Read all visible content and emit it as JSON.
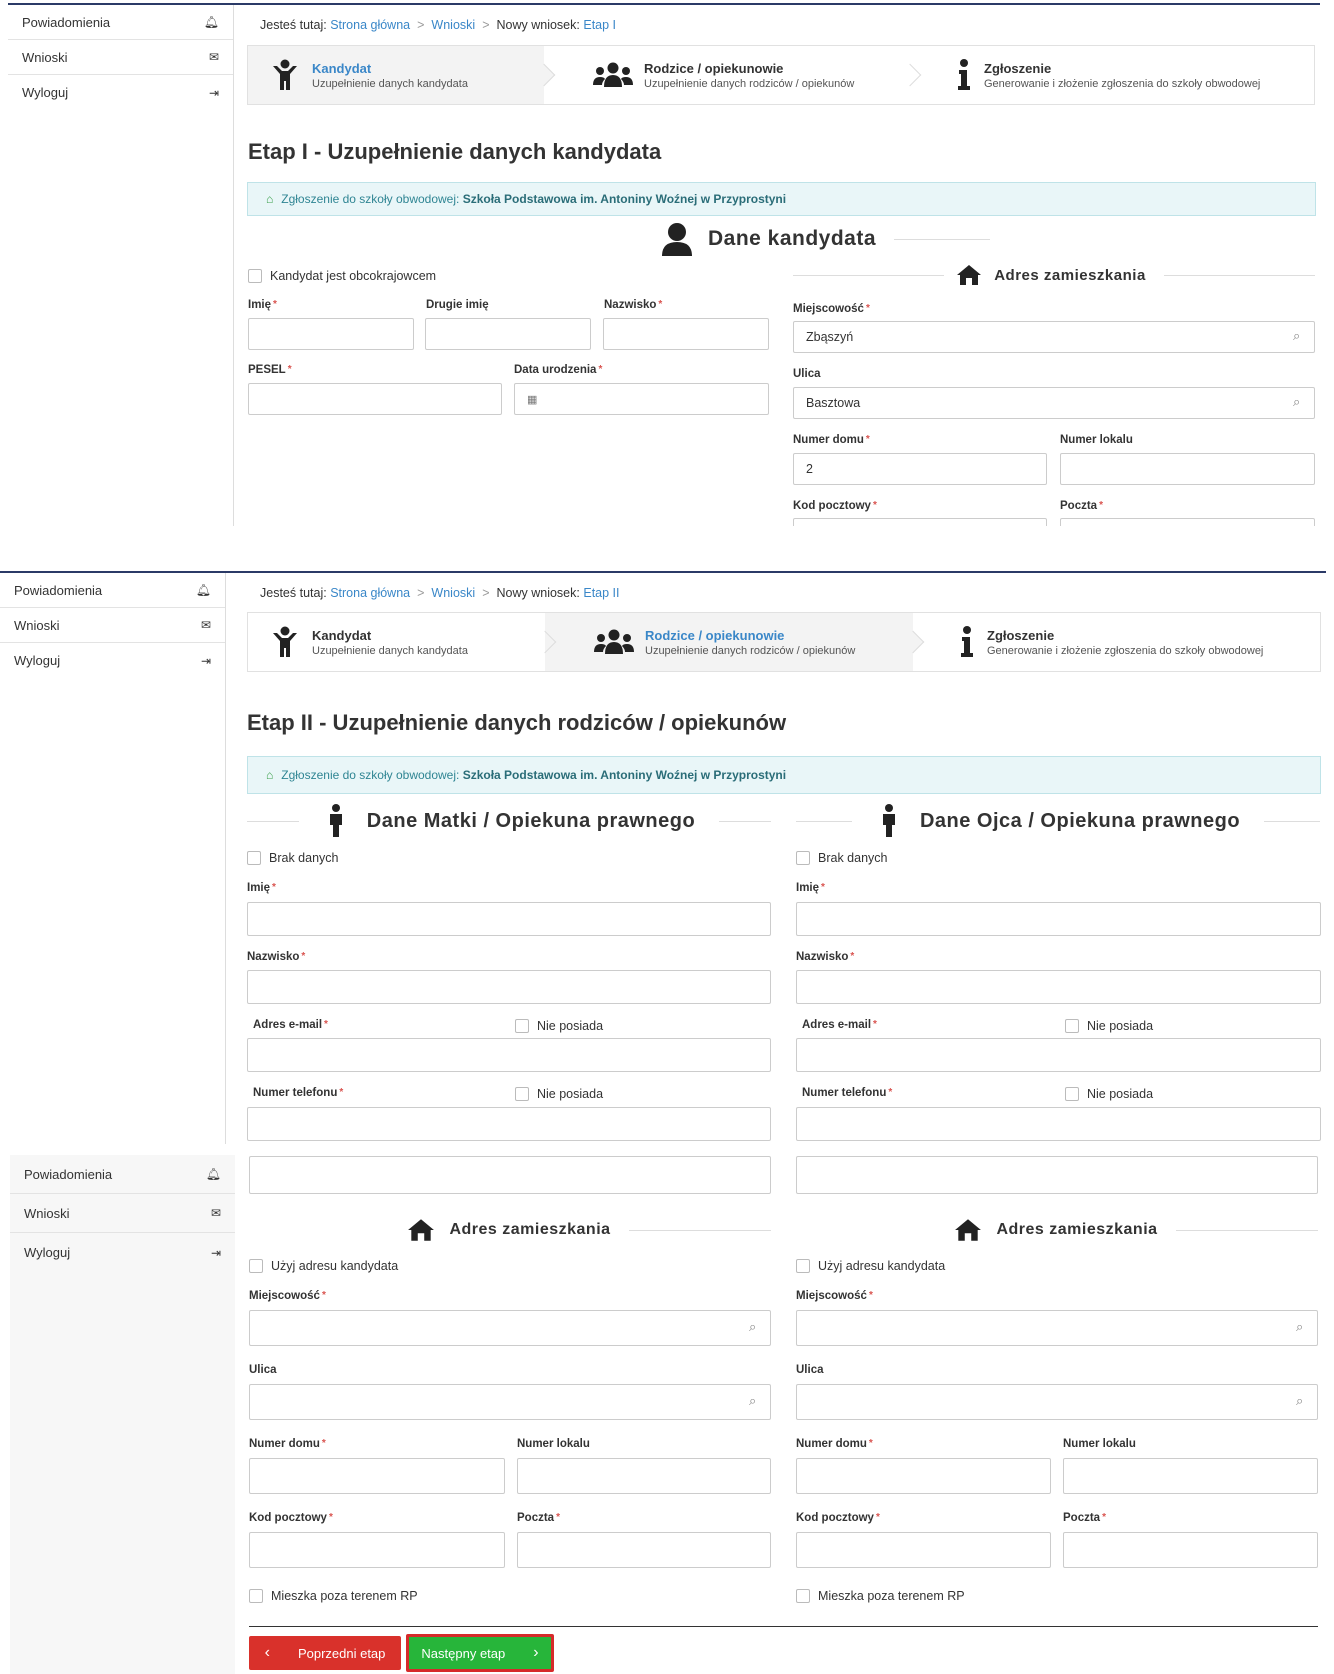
{
  "sidebar": {
    "items": [
      {
        "label": "Powiadomienia",
        "icon": "bell-icon"
      },
      {
        "label": "Wnioski",
        "icon": "envelope-icon"
      },
      {
        "label": "Wyloguj",
        "icon": "sign-out-icon"
      }
    ]
  },
  "breadcrumb": {
    "prefix": "Jesteś tutaj:",
    "home": "Strona główna",
    "requests": "Wnioski",
    "current_label": "Nowy wniosek:",
    "stage1": "Etap I",
    "stage2": "Etap II"
  },
  "steps": [
    {
      "title": "Kandydat",
      "subtitle": "Uzupełnienie danych kandydata"
    },
    {
      "title": "Rodzice / opiekunowie",
      "subtitle": "Uzupełnienie danych rodziców / opiekunów"
    },
    {
      "title": "Zgłoszenie",
      "subtitle": "Generowanie i złożenie zgłoszenia do szkoły obwodowej"
    }
  ],
  "stage1": {
    "heading": "Etap I - Uzupełnienie danych kandydata",
    "alert_prefix": "Zgłoszenie do szkoły obwodowej:",
    "alert_school": "Szkoła Podstawowa im. Antoniny Woźnej w Przyprostyni",
    "section_title": "Dane kandydata",
    "foreigner_label": "Kandydat jest obcokrajowcem",
    "first_name_label": "Imię",
    "second_name_label": "Drugie imię",
    "surname_label": "Nazwisko",
    "pesel_label": "PESEL",
    "birth_date_label": "Data urodzenia",
    "address_title": "Adres zamieszkania",
    "city_label": "Miejscowość",
    "city_value": "Zbąszyń",
    "street_label": "Ulica",
    "street_value": "Basztowa",
    "house_label": "Numer domu",
    "house_value": "2",
    "flat_label": "Numer lokalu",
    "postal_label": "Kod pocztowy",
    "post_label": "Poczta"
  },
  "stage2": {
    "heading": "Etap II - Uzupełnienie danych rodziców / opiekunów",
    "mother_title": "Dane Matki / Opiekuna prawnego",
    "father_title": "Dane Ojca / Opiekuna prawnego",
    "no_data": "Brak danych",
    "first_name_label": "Imię",
    "surname_label": "Nazwisko",
    "email_label": "Adres e-mail",
    "phone_label": "Numer telefonu",
    "none_label": "Nie posiada",
    "address_title": "Adres zamieszkania",
    "use_candidate_address": "Użyj adresu kandydata",
    "city_label": "Miejscowość",
    "street_label": "Ulica",
    "house_label": "Numer domu",
    "flat_label": "Numer lokalu",
    "postal_label": "Kod pocztowy",
    "post_label": "Poczta",
    "abroad_label": "Mieszka poza terenem RP",
    "prev_button": "Poprzedni etap",
    "next_button": "Następny etap"
  },
  "colors": {
    "link": "#3a87c8",
    "required": "#d9534f",
    "alert_bg": "#e9f6f8",
    "prev_button": "#d9312b",
    "next_button": "#27b53a"
  }
}
